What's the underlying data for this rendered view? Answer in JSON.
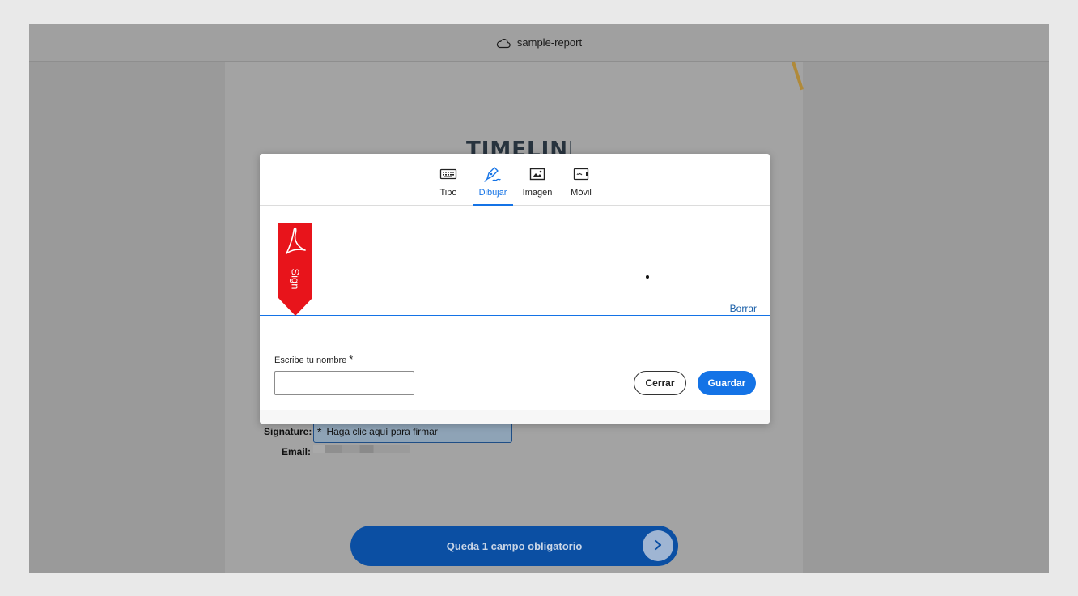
{
  "window": {
    "title": "sample-report",
    "title_icon": "cloud-icon"
  },
  "document": {
    "heading": "TIMELINE",
    "signature_label": "Signature:",
    "signature_placeholder": "Haga clic aquí para firmar",
    "signature_required_mark": "*",
    "email_label": "Email:"
  },
  "footer_bar": {
    "label": "Queda 1 campo obligatorio",
    "next_icon": "chevron-right-icon"
  },
  "modal": {
    "tabs": [
      {
        "label": "Tipo",
        "icon": "keyboard-icon",
        "active": false
      },
      {
        "label": "Dibujar",
        "icon": "pen-icon",
        "active": true
      },
      {
        "label": "Imagen",
        "icon": "image-icon",
        "active": false
      },
      {
        "label": "Móvil",
        "icon": "mobile-icon",
        "active": false
      }
    ],
    "ribbon_text": "Sign",
    "clear_label": "Borrar",
    "name_label": "Escribe tu nombre",
    "name_required_mark": "*",
    "name_value": "",
    "close_label": "Cerrar",
    "save_label": "Guardar"
  },
  "colors": {
    "accent": "#1473e6",
    "ribbon": "#e8141b",
    "footer_bar": "#0b4fa3"
  }
}
